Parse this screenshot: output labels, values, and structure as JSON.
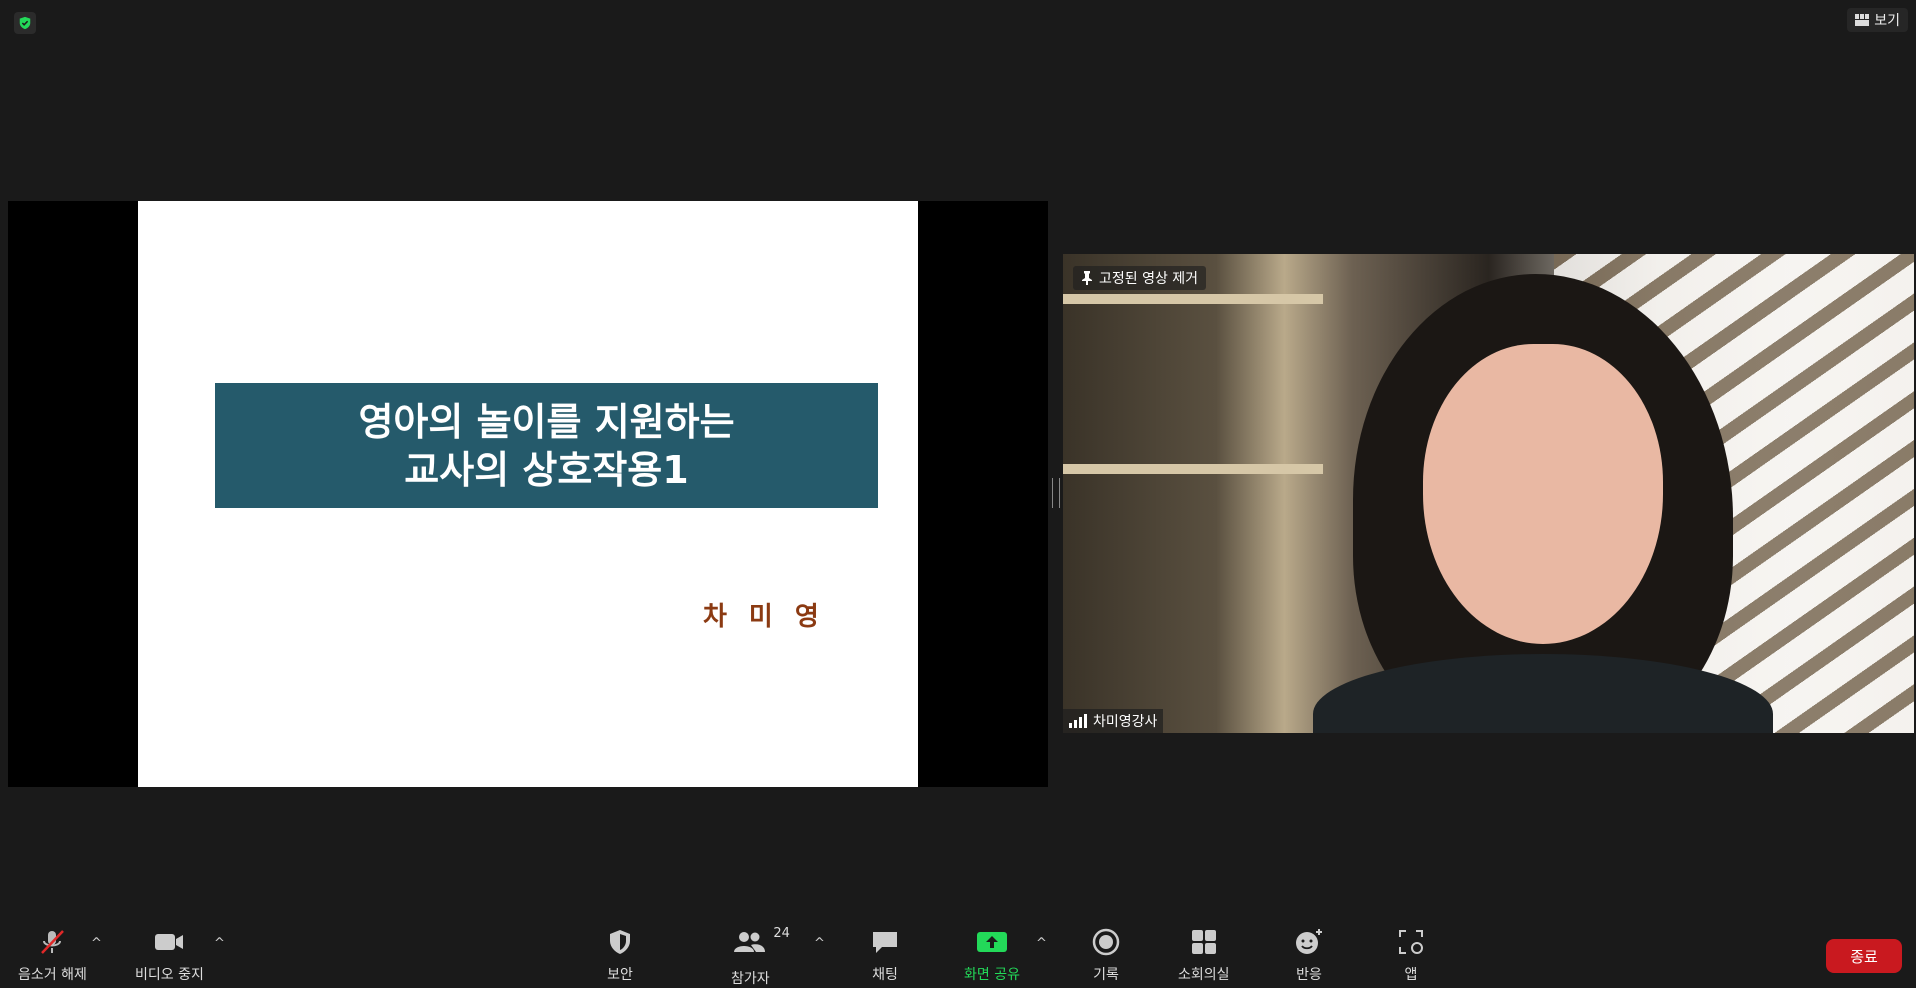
{
  "top": {
    "view_label": "보기"
  },
  "slide": {
    "title_line1": "영아의 놀이를 지원하는",
    "title_line2": "교사의 상호작용1",
    "author": "차미영"
  },
  "video": {
    "unpin_label": "고정된 영상 제거",
    "participant_name": "차미영강사"
  },
  "toolbar": {
    "mute_label": "음소거 해제",
    "video_label": "비디오 중지",
    "security_label": "보안",
    "participants_label": "참가자",
    "participants_count": "24",
    "chat_label": "채팅",
    "share_label": "화면 공유",
    "record_label": "기록",
    "caption_label": "소회의실",
    "reactions_label": "반응",
    "apps_label": "앱",
    "end_label": "종료"
  },
  "colors": {
    "background": "#1a1a1a",
    "slide_title_box": "#255a6b",
    "author_text": "#8b3a12",
    "share_green": "#23d959",
    "end_red": "#c9191f"
  }
}
